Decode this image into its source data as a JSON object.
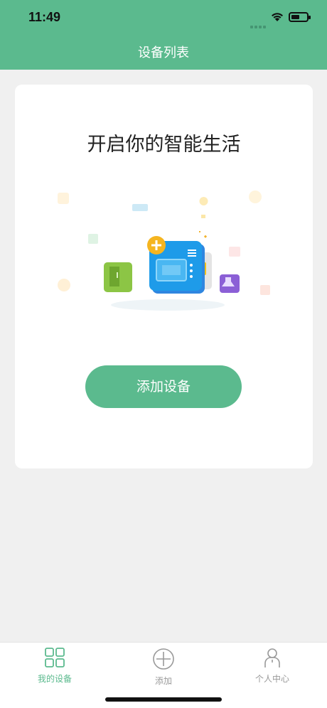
{
  "status_bar": {
    "time": "11:49"
  },
  "header": {
    "title": "设备列表"
  },
  "card": {
    "heading": "开启你的智能生活",
    "add_button_label": "添加设备",
    "illustration_icon": "smart-appliances-illustration"
  },
  "tabbar": {
    "items": [
      {
        "label": "我的设备",
        "icon": "grid-icon",
        "active": true
      },
      {
        "label": "添加",
        "icon": "plus-circle-icon",
        "active": false
      },
      {
        "label": "个人中心",
        "icon": "person-icon",
        "active": false
      }
    ]
  },
  "colors": {
    "accent": "#5bba8e",
    "inactive": "#999999",
    "background": "#f0f0f0"
  }
}
